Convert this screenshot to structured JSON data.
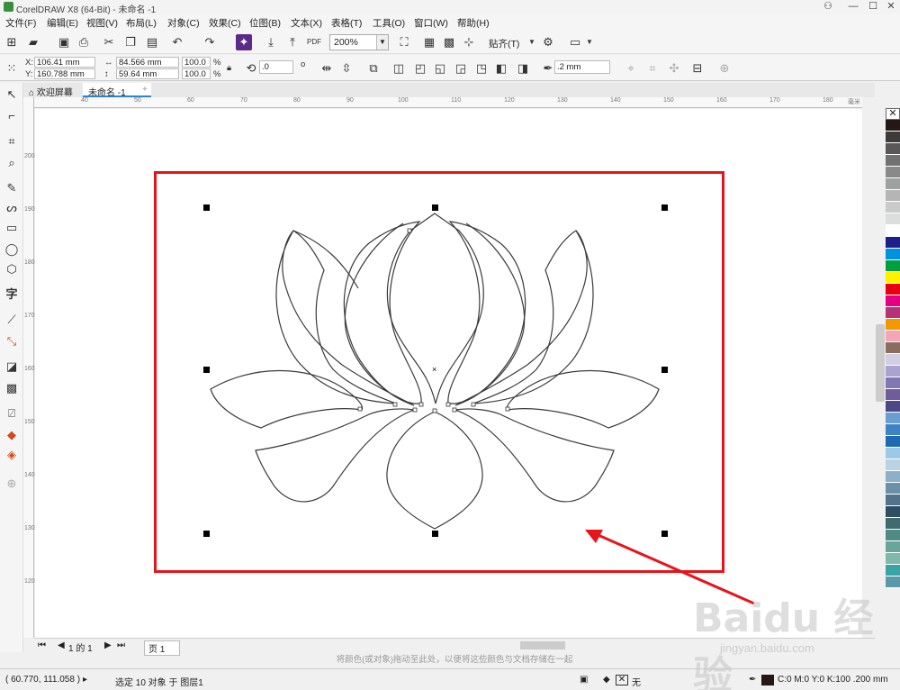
{
  "window": {
    "title": "CorelDRAW X8 (64-Bit) - 未命名 -1",
    "min": "—",
    "max": "☐",
    "close": "✕"
  },
  "menu": [
    "文件(F)",
    "编辑(E)",
    "视图(V)",
    "布局(L)",
    "对象(C)",
    "效果(C)",
    "位图(B)",
    "文本(X)",
    "表格(T)",
    "工具(O)",
    "窗口(W)",
    "帮助(H)"
  ],
  "toolbar": {
    "zoom": "200%",
    "snap_label": "贴齐(T)",
    "pdf_label": "PDF"
  },
  "props": {
    "x": "106.41 mm",
    "y": "160.788 mm",
    "w": "84.566 mm",
    "h": "59.64 mm",
    "sx": "100.0",
    "sy": "100.0",
    "pct": "%",
    "rotation": ".0",
    "degree": "o",
    "outline": ".2 mm"
  },
  "tabs": {
    "welcome": "欢迎屏幕",
    "doc": "未命名 -1",
    "add": "+"
  },
  "rulers": {
    "h": [
      "40",
      "50",
      "60",
      "70",
      "80",
      "90",
      "100",
      "110",
      "120",
      "130",
      "140",
      "150",
      "160",
      "170",
      "180"
    ],
    "v": [
      "200",
      "190",
      "180",
      "170",
      "160",
      "150",
      "140",
      "130",
      "120"
    ],
    "h_unit": "毫米"
  },
  "palette": [
    "#231815",
    "#3e3a39",
    "#595757",
    "#727171",
    "#898989",
    "#9fa0a0",
    "#b5b5b6",
    "#c9caca",
    "#dcdddd",
    "#ffffff",
    "#1d2088",
    "#0092e0",
    "#00a040",
    "#fff100",
    "#e60012",
    "#e4007f",
    "#b63379",
    "#f39800",
    "#f5a6b6",
    "#8c6c5d",
    "#d2cfe5",
    "#a9a3cf",
    "#8077b4",
    "#6e5d9a",
    "#4e4785",
    "#6a9dd2",
    "#3c82c4",
    "#1c6bb0",
    "#9cc9e6",
    "#b9d3e2",
    "#8ab1c8",
    "#6b91a9",
    "#54728a",
    "#2f4e63",
    "#3f6a70",
    "#4f8a86",
    "#6aa59b",
    "#80b8ab",
    "#3aa3a3",
    "#5a9aa8"
  ],
  "pagebar": {
    "count": "1 的 1",
    "page": "页 1"
  },
  "hint": "将颜色(或对象)拖动至此处，以便将这些颜色与文档存储在一起",
  "status": {
    "coords": "( 60.770, 111.058 )",
    "selection": "选定 10 对象 于 图层1",
    "fill_none": "无",
    "outline_info": "C:0 M:0 Y:0 K:100  .200 mm"
  },
  "watermark": {
    "logo": "Baidu 经验",
    "url": "jingyan.baidu.com"
  },
  "colors": {
    "selection": "#e8141a",
    "accent": "#2b84d8"
  }
}
